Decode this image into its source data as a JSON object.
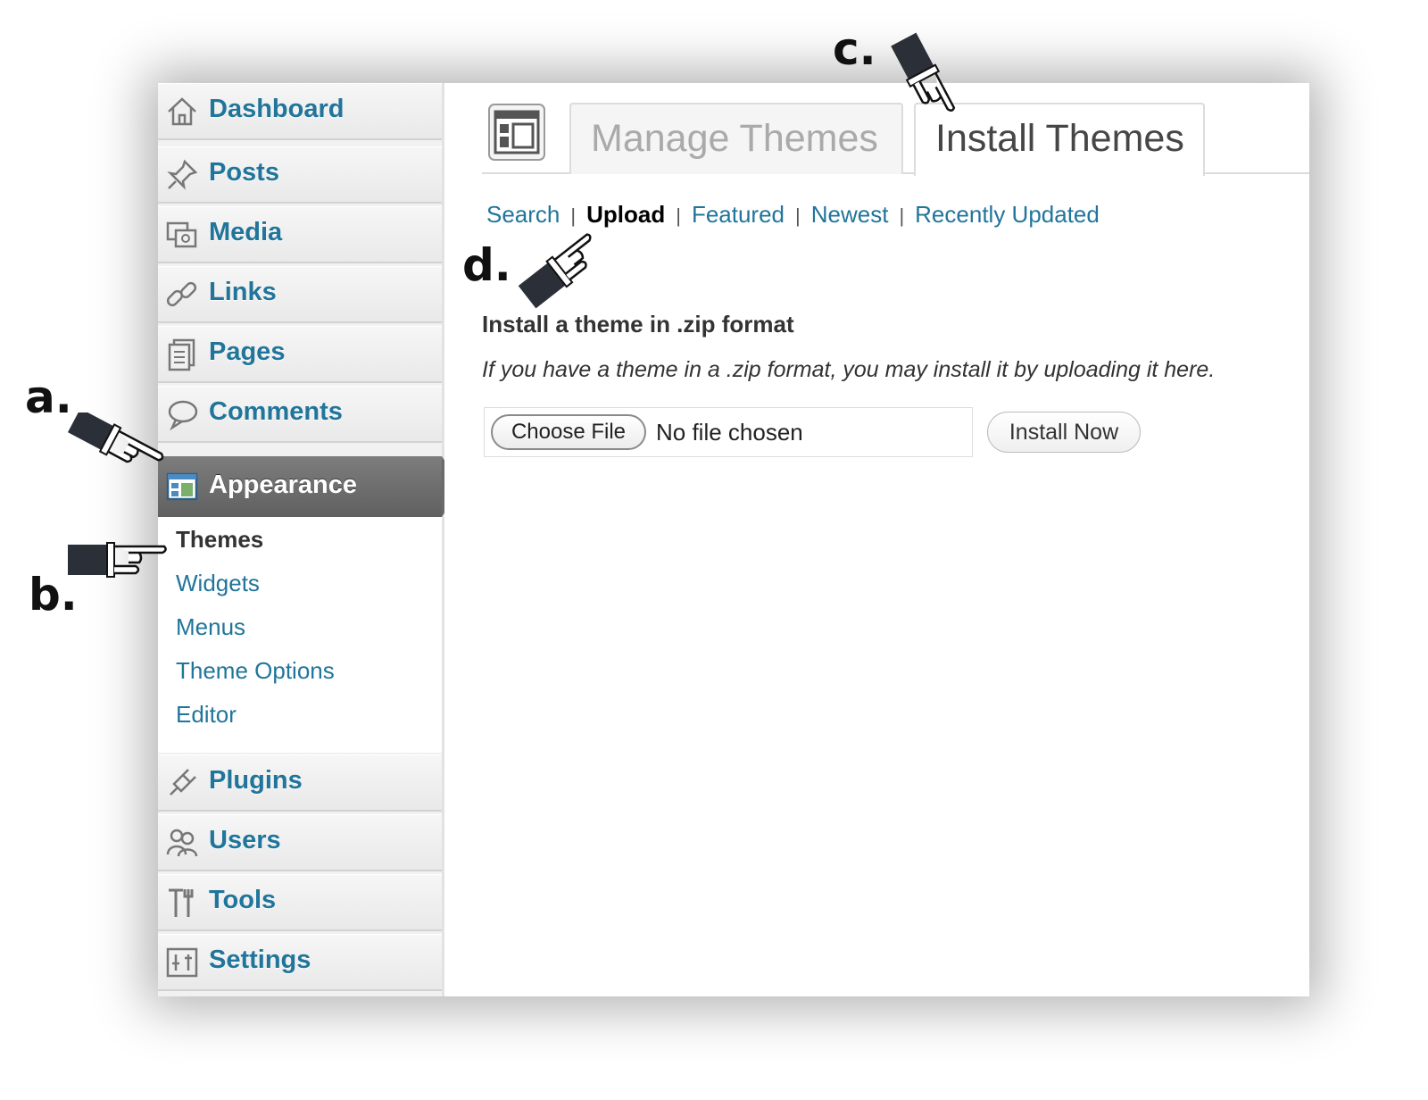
{
  "sidebar": {
    "items": [
      {
        "label": "Dashboard",
        "icon": "home-icon"
      },
      {
        "label": "Posts",
        "icon": "pin-icon"
      },
      {
        "label": "Media",
        "icon": "media-icon"
      },
      {
        "label": "Links",
        "icon": "link-icon"
      },
      {
        "label": "Pages",
        "icon": "pages-icon"
      },
      {
        "label": "Comments",
        "icon": "comment-icon"
      },
      {
        "label": "Appearance",
        "icon": "appearance-icon"
      },
      {
        "label": "Plugins",
        "icon": "plugin-icon"
      },
      {
        "label": "Users",
        "icon": "users-icon"
      },
      {
        "label": "Tools",
        "icon": "tools-icon"
      },
      {
        "label": "Settings",
        "icon": "settings-icon"
      }
    ],
    "submenu": [
      "Themes",
      "Widgets",
      "Menus",
      "Theme Options",
      "Editor"
    ]
  },
  "tabs": {
    "manage": "Manage Themes",
    "install": "Install Themes"
  },
  "subnav": {
    "items": [
      "Search",
      "Upload",
      "Featured",
      "Newest",
      "Recently Updated"
    ],
    "separator": "|"
  },
  "upload": {
    "heading": "Install a theme in .zip format",
    "description": "If you have a theme in a .zip format, you may install it by uploading it here.",
    "choose_label": "Choose File",
    "no_file": "No file chosen",
    "install_label": "Install Now"
  },
  "annotations": {
    "a": "a.",
    "b": "b.",
    "c": "c.",
    "d": "d."
  },
  "colors": {
    "link": "#21759b",
    "active_menu": "#6a6a6a",
    "pointer": "#2b2f38"
  }
}
